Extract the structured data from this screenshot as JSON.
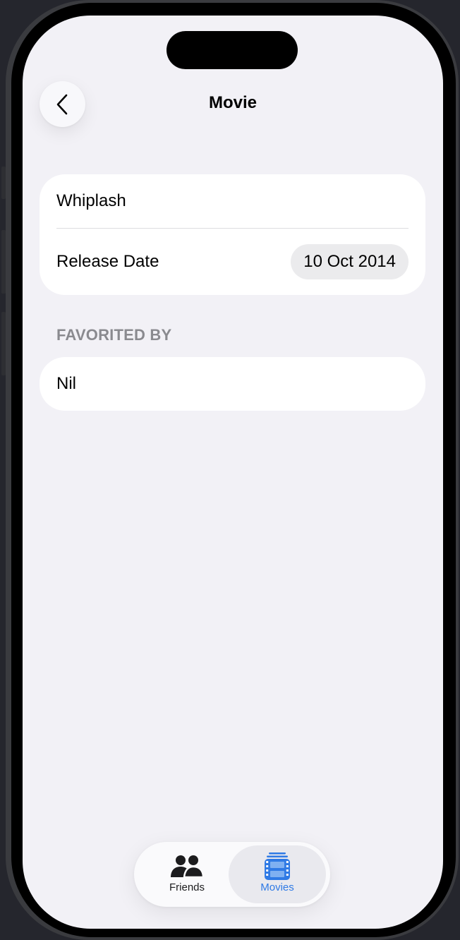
{
  "navigation": {
    "title": "Movie",
    "back_icon": "chevron-left-icon"
  },
  "movie": {
    "title": "Whiplash",
    "release_date_label": "Release Date",
    "release_date_value": "10 Oct 2014"
  },
  "favorited_section": {
    "header": "FAVORITED BY",
    "items": [
      "Nil"
    ]
  },
  "tab_bar": {
    "tabs": [
      {
        "label": "Friends",
        "icon": "people-icon",
        "selected": false
      },
      {
        "label": "Movies",
        "icon": "film-icon",
        "selected": true
      }
    ],
    "accent_color": "#2f7ae5"
  },
  "colors": {
    "background": "#f2f1f6",
    "card": "#ffffff",
    "section_header": "#8a8a8f"
  }
}
